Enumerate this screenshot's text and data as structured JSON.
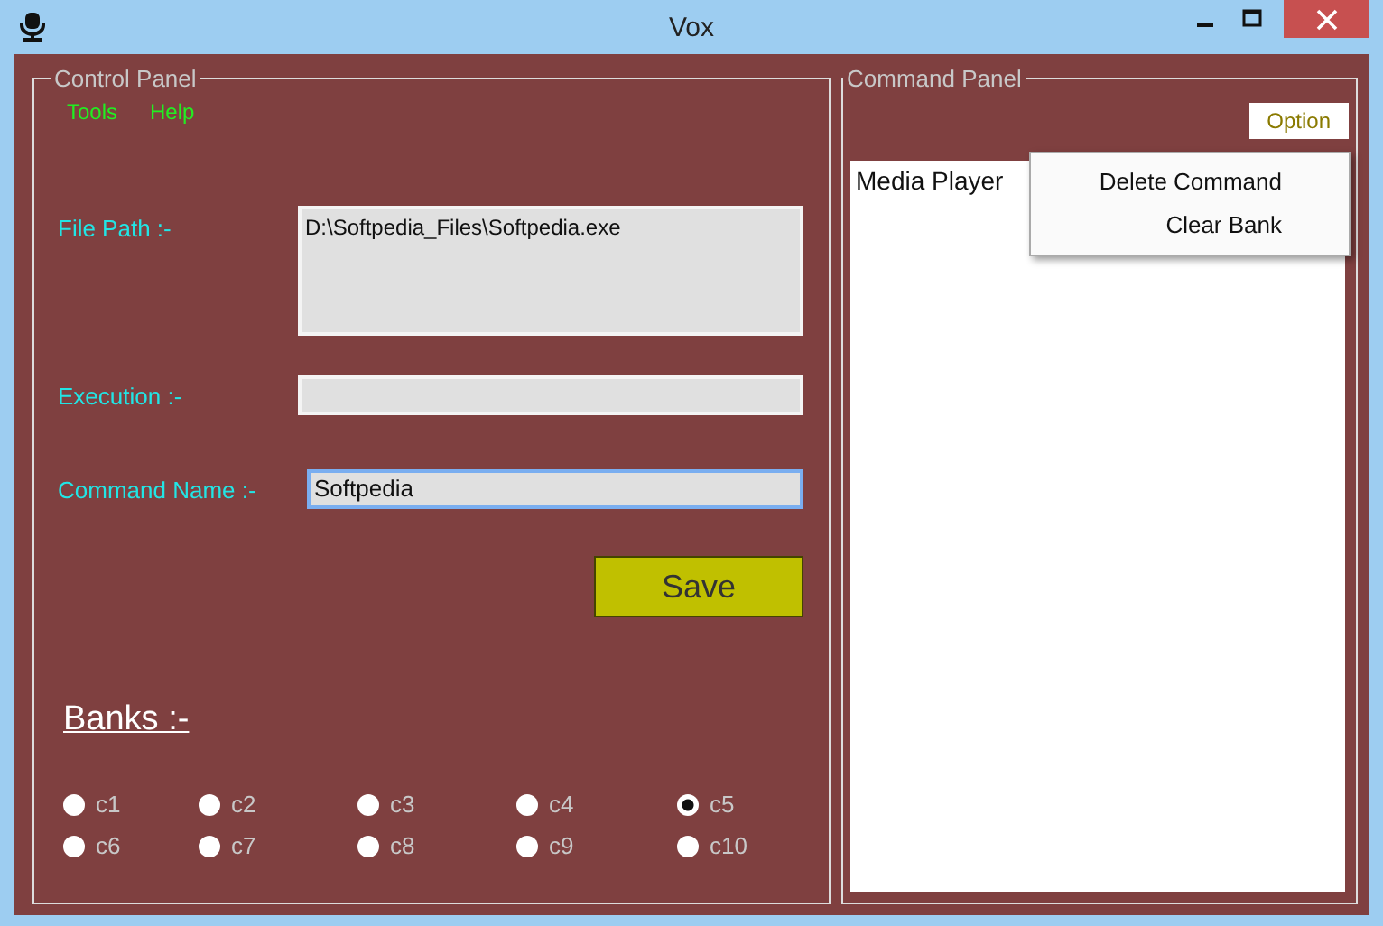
{
  "window": {
    "title": "Vox"
  },
  "control_panel": {
    "title": "Control Panel",
    "menu": [
      "Tools",
      "Help"
    ],
    "fields": [
      {
        "label": "File Path :-",
        "value": "D:\\Softpedia_Files\\Softpedia.exe",
        "kind": "multiline",
        "focused": false
      },
      {
        "label": "Execution :-",
        "kind": "single",
        "focused": false
      },
      {
        "label": "Command Name :-",
        "value": "Softpedia",
        "kind": "single",
        "focused": true
      }
    ],
    "save_button": "Save",
    "banks_label": "Banks :-",
    "banks": [
      {
        "label": "c1",
        "selected": false
      },
      {
        "label": "c2",
        "selected": false
      },
      {
        "label": "c3",
        "selected": false
      },
      {
        "label": "c4",
        "selected": false
      },
      {
        "label": "c5",
        "selected": true
      },
      {
        "label": "c6",
        "selected": false
      },
      {
        "label": "c7",
        "selected": false
      },
      {
        "label": "c8",
        "selected": false
      },
      {
        "label": "c9",
        "selected": false
      },
      {
        "label": "c10",
        "selected": false
      }
    ]
  },
  "command_panel": {
    "title": "Command Panel",
    "option_tab": "Option",
    "commands": [
      "Media Player"
    ],
    "context_menu": [
      "Delete Command",
      "Clear Bank"
    ]
  }
}
